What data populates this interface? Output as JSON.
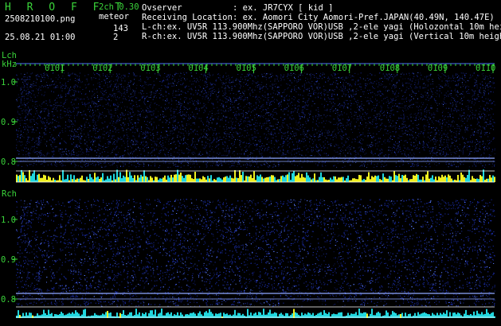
{
  "header": {
    "app_title": "H R O F F T",
    "version": "2ch 0.30",
    "filename": "2508210100.png",
    "mode": "meteor",
    "datetime": "25.08.21 01:00",
    "count_l": "143",
    "count_r": "2",
    "observer_label": "Ovserver",
    "observer_value": ": ex. JR7CYX [ kid ]",
    "location_label": "Receiving Location",
    "location_value": ": ex. Aomori City Aomori-Pref.JAPAN(40.49N, 140.47E)",
    "lch_desc": "L-ch:ex. UV5R 113.900Mhz(SAPPORO VOR)USB ,2-ele yagi (Holozontal 10m height)",
    "rch_desc": "R-ch:ex. UV5R 113.900Mhz(SAPPORO VOR)USB ,2-ele yagi (Vertical 10m height)"
  },
  "axis": {
    "lch_label": "Lch",
    "unit": "kHz",
    "rch_label": "Rch",
    "time_ticks": [
      "0101",
      "0102",
      "0103",
      "0104",
      "0105",
      "0106",
      "0107",
      "0108",
      "0109",
      "0110"
    ],
    "freq_ticks_l": [
      "1.0",
      "0.9",
      "0.8"
    ],
    "freq_ticks_r": [
      "1.0",
      "0.9",
      "0.8"
    ]
  },
  "colors": {
    "background": "#000000",
    "label_green": "#3ad43a",
    "text_white": "#ffffff",
    "noise_blue": "#1a2a9a",
    "level_yellow": "#f0f020",
    "level_cyan": "#20d8e0",
    "marker_line": "#8fa8ff"
  }
}
